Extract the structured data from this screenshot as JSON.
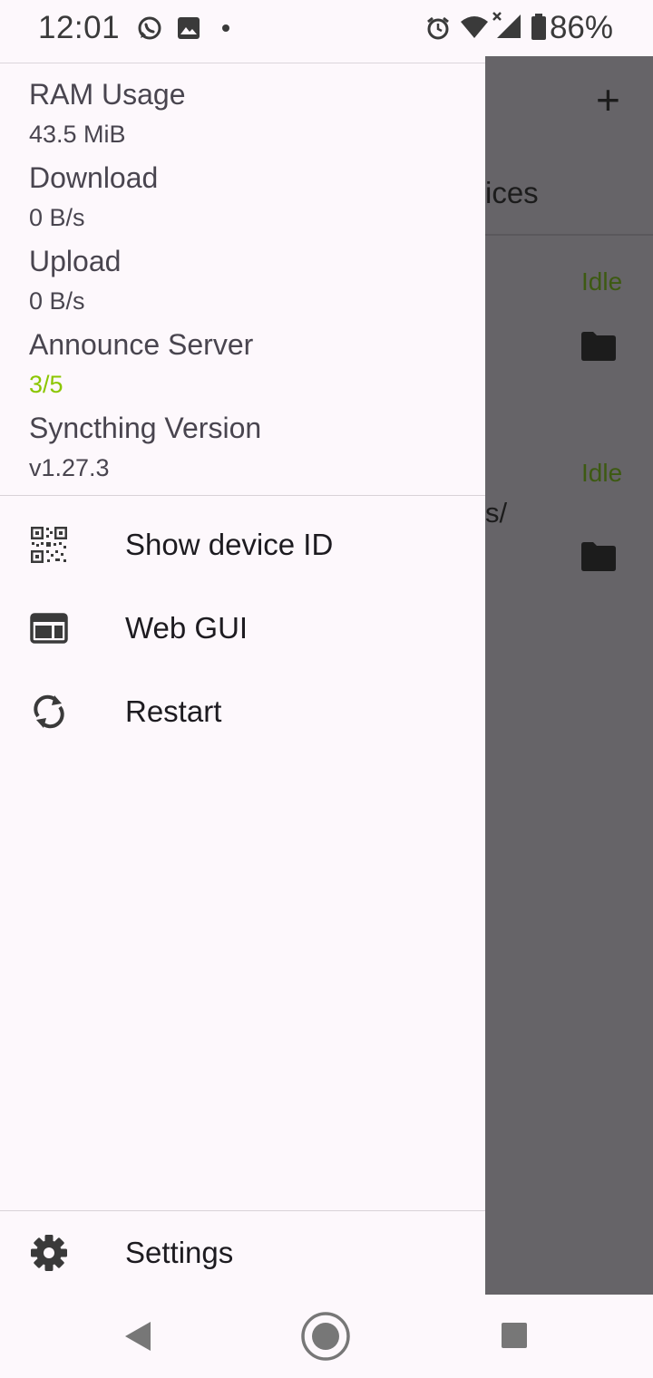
{
  "status_bar": {
    "time": "12:01",
    "battery_percent": "86%",
    "icons": [
      "whatsapp-icon",
      "gallery-icon",
      "dot-icon",
      "alarm-icon",
      "wifi-icon",
      "signal-icon",
      "battery-icon"
    ]
  },
  "drawer": {
    "stats": [
      {
        "label": "RAM Usage",
        "value": "43.5 MiB"
      },
      {
        "label": "Download",
        "value": "0 B/s"
      },
      {
        "label": "Upload",
        "value": "0 B/s"
      },
      {
        "label": "Announce Server",
        "value": "3/5",
        "value_color": "#8bc600"
      },
      {
        "label": "Syncthing Version",
        "value": "v1.27.3"
      }
    ],
    "menu": [
      {
        "label": "Show device ID",
        "icon": "qr-code-icon"
      },
      {
        "label": "Web GUI",
        "icon": "web-window-icon"
      },
      {
        "label": "Restart",
        "icon": "refresh-icon"
      }
    ],
    "footer": {
      "label": "Settings",
      "icon": "gear-icon"
    }
  },
  "background_app": {
    "tab_fragment": "ices",
    "path_fragment": "s/",
    "folder_status_1": "Idle",
    "folder_status_2": "Idle"
  },
  "navigation_bar": {
    "buttons": [
      "back-icon",
      "home-icon",
      "recents-icon"
    ]
  },
  "colors": {
    "drawer_background": "#fdf8fc",
    "scrim": "#666468",
    "accent_green": "#8bc600"
  }
}
